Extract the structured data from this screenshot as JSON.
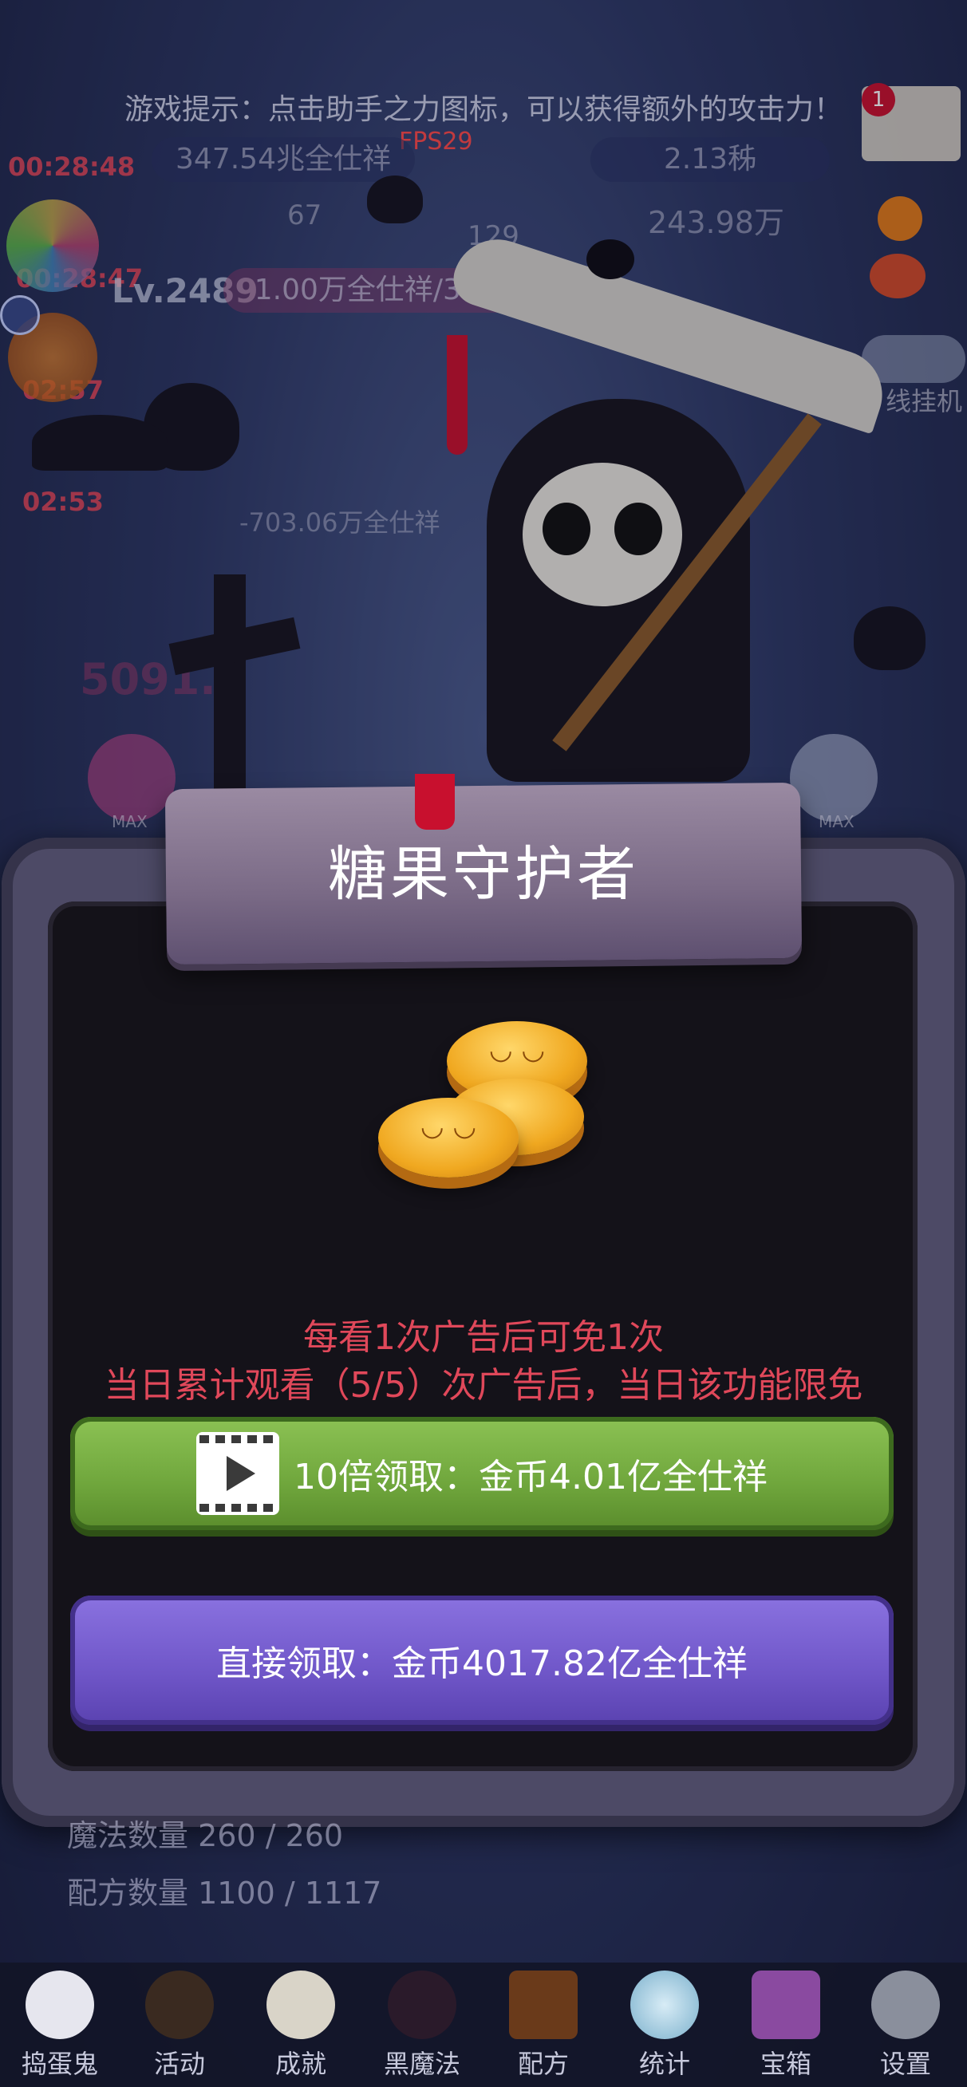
{
  "hud": {
    "tip": "游戏提示：点击助手之力图标，可以获得额外的攻击力！",
    "fps": "FPS29",
    "gold": "347.54兆全仕祥",
    "gem": "2.13秭",
    "stat_a": "67",
    "stat_b": "129",
    "stat_c": "243.98万",
    "timer_1": "00:28:48",
    "timer_2": "00:28:47",
    "timer_3": "02:57",
    "timer_4": "02:53",
    "level": "Lv.2489",
    "hp": "1.00万全仕祥/3.71万",
    "mail_badge": "1",
    "bg_damage": "-703.06万全仕祥",
    "bg_number": "5091.5",
    "side_label": "线挂机",
    "max_label_left": "MAX",
    "max_label_right": "MAX"
  },
  "dialog": {
    "title": "糖果守护者",
    "notice_line1": "每看1次广告后可免1次",
    "notice_line2": "当日累计观看（5/5）次广告后，当日该功能限免",
    "btn_video_label": "10倍领取：金币4.01亿全仕祥",
    "btn_direct_label": "直接领取：金币4017.82亿全仕祥"
  },
  "stats": {
    "magic_count": "魔法数量 260 / 260",
    "recipe_count": "配方数量 1100 / 1117"
  },
  "nav": [
    {
      "label": "捣蛋鬼",
      "icon": "ghost-icon"
    },
    {
      "label": "活动",
      "icon": "eyeball-basket-icon"
    },
    {
      "label": "成就",
      "icon": "skull-trophy-icon"
    },
    {
      "label": "黑魔法",
      "icon": "demon-icon"
    },
    {
      "label": "配方",
      "icon": "spellbook-icon"
    },
    {
      "label": "统计",
      "icon": "crystal-ball-icon"
    },
    {
      "label": "宝箱",
      "icon": "gift-box-icon"
    },
    {
      "label": "设置",
      "icon": "gear-icon"
    }
  ],
  "colors": {
    "notice": "#e0485a",
    "btn_green": "#6fa63c",
    "btn_purple": "#6f56c8",
    "plaque": "#7a6a86"
  }
}
